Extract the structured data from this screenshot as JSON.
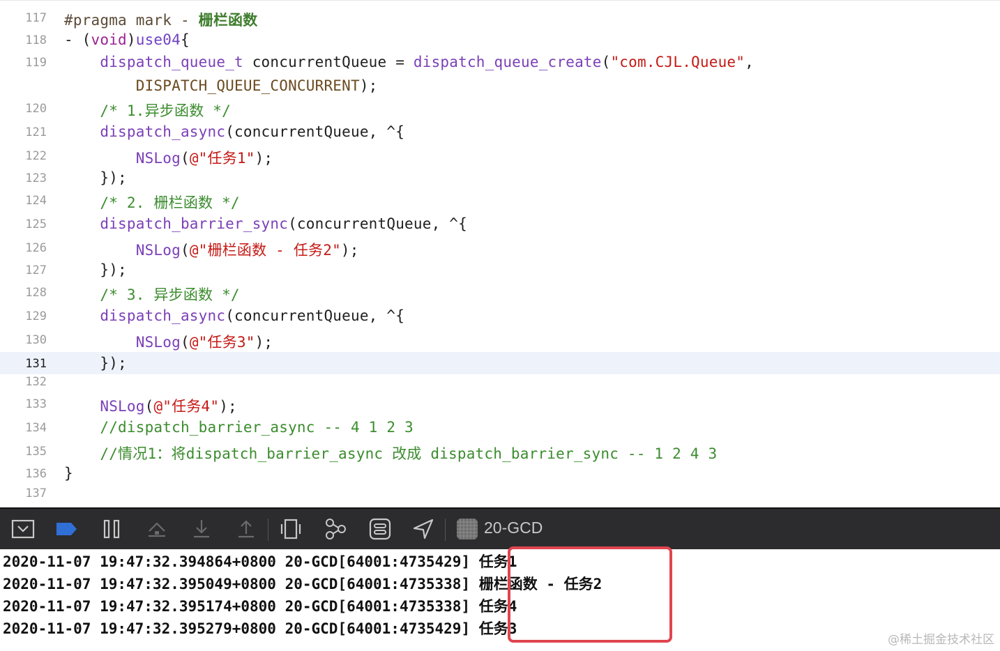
{
  "editor": {
    "lines": [
      {
        "num": "117",
        "segs": [
          {
            "c": "pragma",
            "t": "#pragma mark - "
          },
          {
            "c": "pragma-title",
            "t": "栅栏函数"
          }
        ]
      },
      {
        "num": "118",
        "segs": [
          {
            "c": "",
            "t": "- ("
          },
          {
            "c": "kw",
            "t": "void"
          },
          {
            "c": "",
            "t": ")"
          },
          {
            "c": "fn",
            "t": "use04"
          },
          {
            "c": "",
            "t": "{"
          }
        ]
      },
      {
        "num": "119",
        "segs": [
          {
            "c": "",
            "t": "    "
          },
          {
            "c": "fnp",
            "t": "dispatch_queue_t"
          },
          {
            "c": "",
            "t": " concurrentQueue = "
          },
          {
            "c": "fnp",
            "t": "dispatch_queue_create"
          },
          {
            "c": "",
            "t": "("
          },
          {
            "c": "str",
            "t": "\"com.CJL.Queue\""
          },
          {
            "c": "",
            "t": ","
          }
        ]
      },
      {
        "num": "",
        "segs": [
          {
            "c": "",
            "t": "        "
          },
          {
            "c": "macro",
            "t": "DISPATCH_QUEUE_CONCURRENT"
          },
          {
            "c": "",
            "t": ");"
          }
        ]
      },
      {
        "num": "120",
        "segs": [
          {
            "c": "",
            "t": "    "
          },
          {
            "c": "cmt",
            "t": "/* 1.异步函数 */"
          }
        ]
      },
      {
        "num": "121",
        "segs": [
          {
            "c": "",
            "t": "    "
          },
          {
            "c": "fnp",
            "t": "dispatch_async"
          },
          {
            "c": "",
            "t": "(concurrentQueue, ^{"
          }
        ]
      },
      {
        "num": "122",
        "segs": [
          {
            "c": "",
            "t": "        "
          },
          {
            "c": "fnp",
            "t": "NSLog"
          },
          {
            "c": "",
            "t": "("
          },
          {
            "c": "str",
            "t": "@\"任务1\""
          },
          {
            "c": "",
            "t": ");"
          }
        ]
      },
      {
        "num": "123",
        "segs": [
          {
            "c": "",
            "t": "    });"
          }
        ]
      },
      {
        "num": "124",
        "segs": [
          {
            "c": "",
            "t": "    "
          },
          {
            "c": "cmt",
            "t": "/* 2. 栅栏函数 */"
          }
        ]
      },
      {
        "num": "125",
        "segs": [
          {
            "c": "",
            "t": "    "
          },
          {
            "c": "fnp",
            "t": "dispatch_barrier_sync"
          },
          {
            "c": "",
            "t": "(concurrentQueue, ^{"
          }
        ]
      },
      {
        "num": "126",
        "segs": [
          {
            "c": "",
            "t": "        "
          },
          {
            "c": "fnp",
            "t": "NSLog"
          },
          {
            "c": "",
            "t": "("
          },
          {
            "c": "str",
            "t": "@\"栅栏函数 - 任务2\""
          },
          {
            "c": "",
            "t": ");"
          }
        ]
      },
      {
        "num": "127",
        "segs": [
          {
            "c": "",
            "t": "    });"
          }
        ]
      },
      {
        "num": "128",
        "segs": [
          {
            "c": "",
            "t": "    "
          },
          {
            "c": "cmt",
            "t": "/* 3. 异步函数 */"
          }
        ]
      },
      {
        "num": "129",
        "segs": [
          {
            "c": "",
            "t": "    "
          },
          {
            "c": "fnp",
            "t": "dispatch_async"
          },
          {
            "c": "",
            "t": "(concurrentQueue, ^{"
          }
        ]
      },
      {
        "num": "130",
        "segs": [
          {
            "c": "",
            "t": "        "
          },
          {
            "c": "fnp",
            "t": "NSLog"
          },
          {
            "c": "",
            "t": "("
          },
          {
            "c": "str",
            "t": "@\"任务3\""
          },
          {
            "c": "",
            "t": ");"
          }
        ]
      },
      {
        "num": "131",
        "current": true,
        "segs": [
          {
            "c": "",
            "t": "    });"
          }
        ]
      },
      {
        "num": "132",
        "segs": []
      },
      {
        "num": "133",
        "segs": [
          {
            "c": "",
            "t": "    "
          },
          {
            "c": "fnp",
            "t": "NSLog"
          },
          {
            "c": "",
            "t": "("
          },
          {
            "c": "str",
            "t": "@\"任务4\""
          },
          {
            "c": "",
            "t": ");"
          }
        ]
      },
      {
        "num": "134",
        "segs": [
          {
            "c": "",
            "t": "    "
          },
          {
            "c": "cmt",
            "t": "//dispatch_barrier_async -- 4 1 2 3"
          }
        ]
      },
      {
        "num": "135",
        "segs": [
          {
            "c": "",
            "t": "    "
          },
          {
            "c": "cmt",
            "t": "//情况1：将dispatch_barrier_async 改成 dispatch_barrier_sync -- 1 2 4 3"
          }
        ]
      },
      {
        "num": "136",
        "segs": [
          {
            "c": "",
            "t": "}"
          }
        ]
      },
      {
        "num": "137",
        "segs": []
      }
    ]
  },
  "toolbar": {
    "app_name": "20-GCD",
    "icons": [
      "hide-console-icon",
      "breakpoint-toggle-icon",
      "pause-icon",
      "step-over-icon",
      "step-into-icon",
      "step-out-icon",
      "view-hierarchy-icon",
      "memory-graph-icon",
      "environment-overrides-icon",
      "simulate-location-icon",
      "app-icon"
    ],
    "accent_color": "#2f6fd6"
  },
  "console": {
    "logs": [
      {
        "prefix": "2020-11-07 19:47:32.394864+0800 20-GCD[64001:4735429]",
        "message": "任务1"
      },
      {
        "prefix": "2020-11-07 19:47:32.395049+0800 20-GCD[64001:4735338]",
        "message": "栅栏函数 - 任务2"
      },
      {
        "prefix": "2020-11-07 19:47:32.395174+0800 20-GCD[64001:4735338]",
        "message": "任务4"
      },
      {
        "prefix": "2020-11-07 19:47:32.395279+0800 20-GCD[64001:4735429]",
        "message": "任务3"
      }
    ],
    "highlight_color": "#e0454f",
    "watermark": "@稀土掘金技术社区"
  }
}
